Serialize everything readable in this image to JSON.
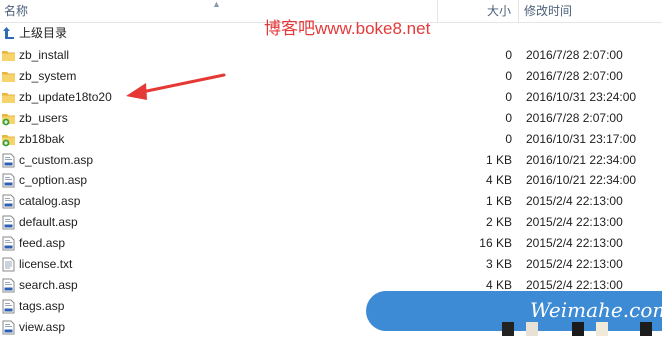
{
  "header": {
    "name": "名称",
    "size": "大小",
    "modified": "修改时间"
  },
  "parent": {
    "label": "上级目录"
  },
  "watermark": "博客吧www.boke8.net",
  "badge": "Weimahe.com",
  "files": [
    {
      "name": "zb_install",
      "size": "0",
      "date": "2016/7/28 2:07:00",
      "icon": "folder-icon"
    },
    {
      "name": "zb_system",
      "size": "0",
      "date": "2016/7/28 2:07:00",
      "icon": "folder-icon"
    },
    {
      "name": "zb_update18to20",
      "size": "0",
      "date": "2016/10/31 23:24:00",
      "icon": "folder-icon"
    },
    {
      "name": "zb_users",
      "size": "0",
      "date": "2016/7/28 2:07:00",
      "icon": "shared-folder-icon"
    },
    {
      "name": "zb18bak",
      "size": "0",
      "date": "2016/10/31 23:17:00",
      "icon": "shared-folder-icon"
    },
    {
      "name": "c_custom.asp",
      "size": "1 KB",
      "date": "2016/10/21 22:34:00",
      "icon": "asp-file-icon"
    },
    {
      "name": "c_option.asp",
      "size": "4 KB",
      "date": "2016/10/21 22:34:00",
      "icon": "asp-file-icon"
    },
    {
      "name": "catalog.asp",
      "size": "1 KB",
      "date": "2015/2/4 22:13:00",
      "icon": "asp-file-icon"
    },
    {
      "name": "default.asp",
      "size": "2 KB",
      "date": "2015/2/4 22:13:00",
      "icon": "asp-file-icon"
    },
    {
      "name": "feed.asp",
      "size": "16 KB",
      "date": "2015/2/4 22:13:00",
      "icon": "asp-file-icon"
    },
    {
      "name": "license.txt",
      "size": "3 KB",
      "date": "2015/2/4 22:13:00",
      "icon": "text-file-icon"
    },
    {
      "name": "search.asp",
      "size": "4 KB",
      "date": "2015/2/4 22:13:00",
      "icon": "asp-file-icon"
    },
    {
      "name": "tags.asp",
      "size": "",
      "date": "",
      "icon": "asp-file-icon"
    },
    {
      "name": "view.asp",
      "size": "",
      "date": "",
      "icon": "asp-file-icon"
    }
  ],
  "colors": {
    "arrow": "#e53935",
    "watermark": "#e33b3b",
    "badge": "#3d8bd4",
    "folder": "#f0c350"
  }
}
